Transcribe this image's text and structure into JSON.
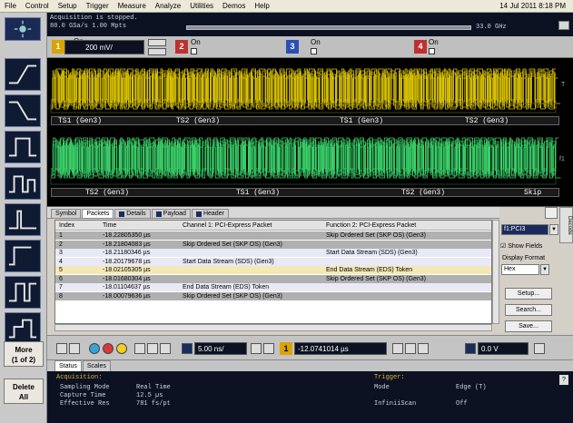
{
  "menu": {
    "items": [
      "File",
      "Control",
      "Setup",
      "Trigger",
      "Measure",
      "Analyze",
      "Utilities",
      "Demos",
      "Help"
    ],
    "clock": "14 Jul 2011  8:18 PM"
  },
  "acquisition": {
    "line1": "Acquisition is stopped.",
    "line2": "80.0 GSa/s   1.00 Mpts",
    "bandwidth": "33.0 GHz"
  },
  "channels": [
    {
      "num": "1",
      "on_label": "On",
      "scale": "200 mV/",
      "color": "#d9a400"
    },
    {
      "num": "2",
      "on_label": "On",
      "color": "#c03030"
    },
    {
      "num": "3",
      "on_label": "On",
      "color": "#2a4fb8"
    },
    {
      "num": "4",
      "on_label": "On",
      "color": "#c03030"
    }
  ],
  "waveform": {
    "lane1_labels": [
      "TS1 (Gen3)",
      "TS2 (Gen3)",
      "TS1 (Gen3)",
      "TS2 (Gen3)"
    ],
    "lane2_labels": [
      "TS2 (Gen3)",
      "TS1 (Gen3)",
      "TS2 (Gen3)",
      "Skip"
    ],
    "marker_top": "T",
    "marker_bottom": "f1"
  },
  "packets": {
    "tabs": [
      "Symbol",
      "Packets",
      "Details",
      "Payload",
      "Header"
    ],
    "active_tab": "Packets",
    "columns": [
      "Index",
      "Time",
      "Channel 1: PCI-Express Packet",
      "Function 2: PCI-Express Packet"
    ],
    "rows": [
      {
        "index": "1",
        "time": "-18.22805350 µs",
        "ch1": "",
        "fn2": "Skip Ordered Set (SKP OS) (Gen3)",
        "style": "sel"
      },
      {
        "index": "2",
        "time": "-18.21804083 µs",
        "ch1": "Skip Ordered Set (SKP OS) (Gen3)",
        "fn2": "",
        "style": "sel"
      },
      {
        "index": "3",
        "time": "-18.21180346 µs",
        "ch1": "",
        "fn2": "Start Data Stream (SDS) (Gen3)",
        "style": "lav"
      },
      {
        "index": "4",
        "time": "-18.20179678 µs",
        "ch1": "Start Data Stream (SDS) (Gen3)",
        "fn2": "",
        "style": "lav"
      },
      {
        "index": "5",
        "time": "-18.02105305 µs",
        "ch1": "",
        "fn2": "End Data Stream (EDS) Token",
        "style": "yel"
      },
      {
        "index": "6",
        "time": "-18.01680304 µs",
        "ch1": "",
        "fn2": "Skip Ordered Set (SKP OS) (Gen3)",
        "style": "sel"
      },
      {
        "index": "7",
        "time": "-18.01104637 µs",
        "ch1": "End Data Stream (EDS) Token",
        "fn2": "",
        "style": "lav"
      },
      {
        "index": "8",
        "time": "-18.00079636 µs",
        "ch1": "Skip Ordered Set (SKP OS) (Gen3)",
        "fn2": "",
        "style": "sel"
      }
    ]
  },
  "right_panel": {
    "source": "f1:PCI3",
    "show_fields": "Show Fields",
    "display_format_label": "Display Format",
    "display_format_value": "Hex",
    "setup_button": "Setup...",
    "search_button": "Search...",
    "save_button": "Save...",
    "side_tab": "Decode"
  },
  "left_panel": {
    "more_button": "More\n(1 of 2)",
    "more_line1": "More",
    "more_line2": "(1 of 2)",
    "delete_line1": "Delete",
    "delete_line2": "All"
  },
  "controls": {
    "time_scale": "5.00 ns/",
    "trigger_pos": "-12.0741014 µs",
    "trigger_level": "0.0 V",
    "trigger_channel": "1"
  },
  "status": {
    "tabs": [
      "Status",
      "Scales"
    ],
    "acq_head": "Acquisition:",
    "acq_rows": [
      {
        "label": "Sampling Mode",
        "value": "Real Time"
      },
      {
        "label": "Capture Time",
        "value": "12.5 µs"
      },
      {
        "label": "Effective Res",
        "value": "781 fs/pt"
      }
    ],
    "trig_head": "Trigger:",
    "trig_rows": [
      {
        "label": "Mode",
        "value": "Edge (T)"
      },
      {
        "label": "InfiniiScan",
        "value": "Off"
      }
    ]
  },
  "colors": {
    "wave_yellow": "#d9c200",
    "wave_green": "#3bd16a",
    "dark_panel": "#0c1222"
  }
}
